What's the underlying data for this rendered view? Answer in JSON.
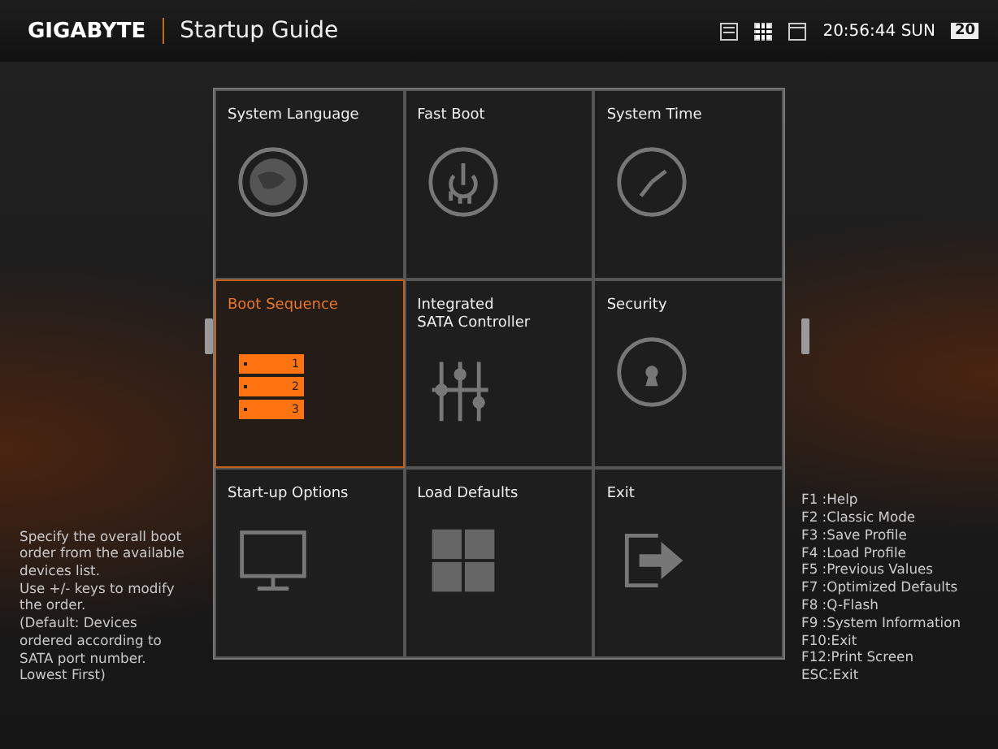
{
  "header": {
    "brand": "GIGABYTE",
    "title": "Startup Guide",
    "view_modes": [
      {
        "selected": false
      },
      {
        "selected": true
      },
      {
        "selected": false
      }
    ],
    "time": "20:56:44",
    "day": "SUN",
    "date": "20"
  },
  "tiles": [
    {
      "label": "System Language",
      "kind": "globe",
      "selected": false
    },
    {
      "label": "Fast Boot",
      "kind": "power",
      "selected": false
    },
    {
      "label": "System Time",
      "kind": "clock",
      "selected": false
    },
    {
      "label": "Boot Sequence",
      "kind": "boot",
      "selected": true,
      "numbers": [
        "1",
        "2",
        "3"
      ]
    },
    {
      "label": "Integrated\nSATA Controller",
      "kind": "sliders",
      "selected": false
    },
    {
      "label": "Security",
      "kind": "lock",
      "selected": false
    },
    {
      "label": "Start-up Options",
      "kind": "monitor",
      "selected": false
    },
    {
      "label": "Load Defaults",
      "kind": "grid",
      "selected": false
    },
    {
      "label": "Exit",
      "kind": "exit",
      "selected": false
    }
  ],
  "help_text": "Specify the overall boot order from the available devices list.\nUse +/- keys to modify the order.\n(Default: Devices ordered according to SATA port number. Lowest First)",
  "hotkeys": [
    "F1 :Help",
    "F2 :Classic Mode",
    "F3 :Save Profile",
    "F4 :Load Profile",
    "F5 :Previous Values",
    "F7 :Optimized Defaults",
    "F8 :Q-Flash",
    "F9 :System Information",
    "F10:Exit",
    "F12:Print Screen",
    "ESC:Exit"
  ]
}
